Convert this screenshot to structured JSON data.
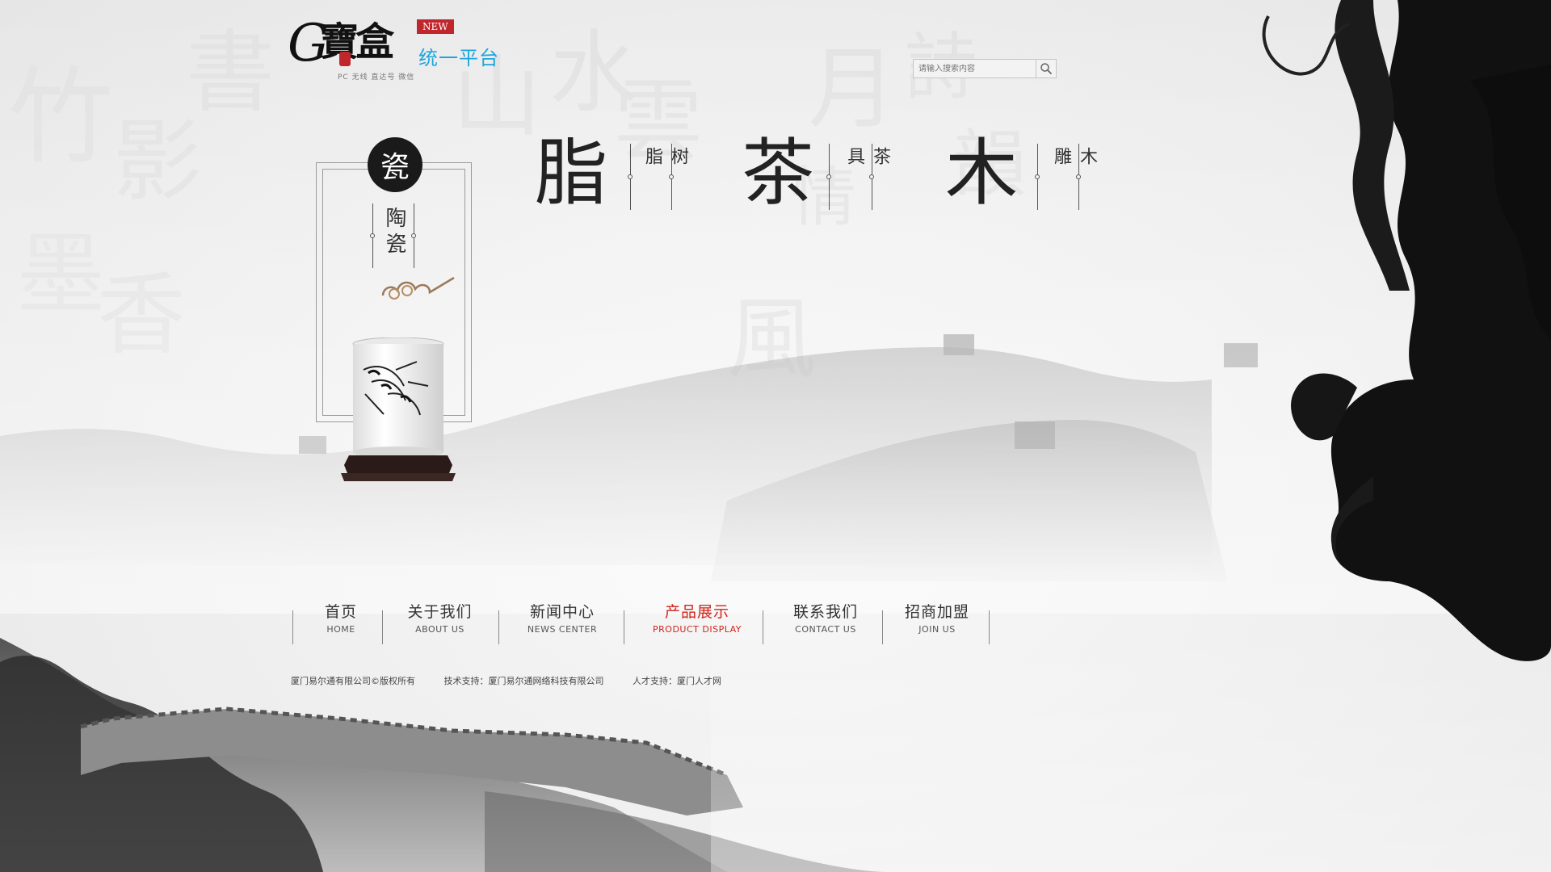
{
  "logo": {
    "badge": "NEW",
    "platform": "统一平台",
    "subtitle": "PC 无线 直达号 微信",
    "mark_letter": "G",
    "mark_chars": "寶盒"
  },
  "search": {
    "placeholder": "请输入搜索内容",
    "icon": "search-icon"
  },
  "feature": {
    "circle_char": "瓷",
    "label": "陶瓷"
  },
  "categories": [
    {
      "big": "脂",
      "small": "树脂"
    },
    {
      "big": "茶",
      "small": "茶具"
    },
    {
      "big": "木",
      "small": "木雕"
    }
  ],
  "nav": [
    {
      "cn": "首页",
      "en": "HOME",
      "active": false
    },
    {
      "cn": "关于我们",
      "en": "ABOUT US",
      "active": false
    },
    {
      "cn": "新闻中心",
      "en": "NEWS CENTER",
      "active": false
    },
    {
      "cn": "产品展示",
      "en": "PRODUCT DISPLAY",
      "active": true
    },
    {
      "cn": "联系我们",
      "en": "CONTACT US",
      "active": false
    },
    {
      "cn": "招商加盟",
      "en": "JOIN US",
      "active": false
    }
  ],
  "footer": {
    "copyright": "厦门易尔通有限公司©版权所有",
    "tech": "技术支持：厦门易尔通网络科技有限公司",
    "talent": "人才支持：厦门人才网"
  },
  "colors": {
    "accent_red": "#d0231a",
    "platform_blue": "#1da6dc",
    "ink": "#111111"
  }
}
